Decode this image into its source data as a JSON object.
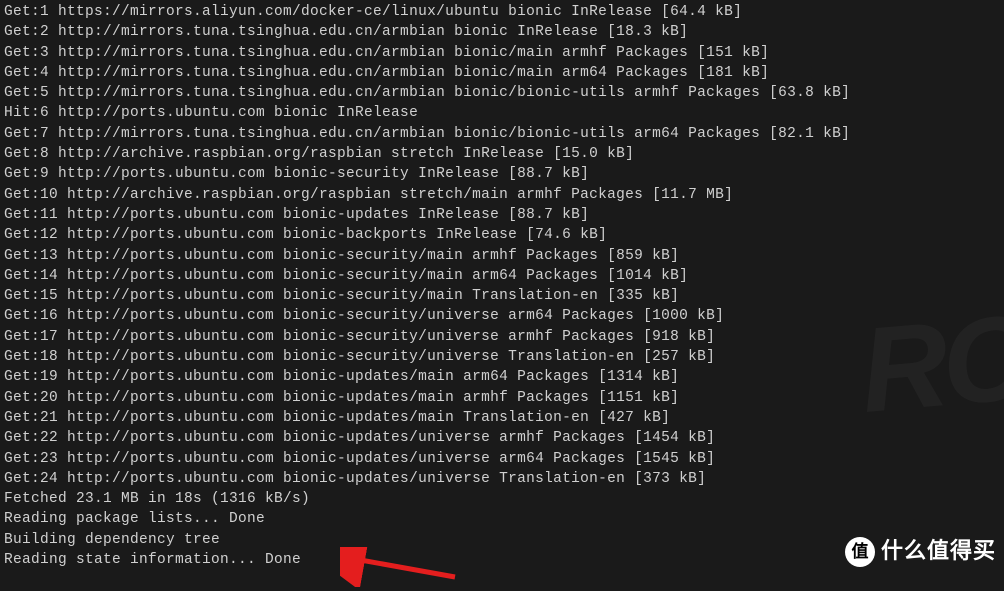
{
  "terminal": {
    "lines": [
      "Get:1 https://mirrors.aliyun.com/docker-ce/linux/ubuntu bionic InRelease [64.4 kB]",
      "Get:2 http://mirrors.tuna.tsinghua.edu.cn/armbian bionic InRelease [18.3 kB]",
      "Get:3 http://mirrors.tuna.tsinghua.edu.cn/armbian bionic/main armhf Packages [151 kB]",
      "Get:4 http://mirrors.tuna.tsinghua.edu.cn/armbian bionic/main arm64 Packages [181 kB]",
      "Get:5 http://mirrors.tuna.tsinghua.edu.cn/armbian bionic/bionic-utils armhf Packages [63.8 kB]",
      "Hit:6 http://ports.ubuntu.com bionic InRelease",
      "Get:7 http://mirrors.tuna.tsinghua.edu.cn/armbian bionic/bionic-utils arm64 Packages [82.1 kB]",
      "Get:8 http://archive.raspbian.org/raspbian stretch InRelease [15.0 kB]",
      "Get:9 http://ports.ubuntu.com bionic-security InRelease [88.7 kB]",
      "Get:10 http://archive.raspbian.org/raspbian stretch/main armhf Packages [11.7 MB]",
      "Get:11 http://ports.ubuntu.com bionic-updates InRelease [88.7 kB]",
      "Get:12 http://ports.ubuntu.com bionic-backports InRelease [74.6 kB]",
      "Get:13 http://ports.ubuntu.com bionic-security/main armhf Packages [859 kB]",
      "Get:14 http://ports.ubuntu.com bionic-security/main arm64 Packages [1014 kB]",
      "Get:15 http://ports.ubuntu.com bionic-security/main Translation-en [335 kB]",
      "Get:16 http://ports.ubuntu.com bionic-security/universe arm64 Packages [1000 kB]",
      "Get:17 http://ports.ubuntu.com bionic-security/universe armhf Packages [918 kB]",
      "Get:18 http://ports.ubuntu.com bionic-security/universe Translation-en [257 kB]",
      "Get:19 http://ports.ubuntu.com bionic-updates/main arm64 Packages [1314 kB]",
      "Get:20 http://ports.ubuntu.com bionic-updates/main armhf Packages [1151 kB]",
      "Get:21 http://ports.ubuntu.com bionic-updates/main Translation-en [427 kB]",
      "Get:22 http://ports.ubuntu.com bionic-updates/universe armhf Packages [1454 kB]",
      "Get:23 http://ports.ubuntu.com bionic-updates/universe arm64 Packages [1545 kB]",
      "Get:24 http://ports.ubuntu.com bionic-updates/universe Translation-en [373 kB]",
      "Fetched 23.1 MB in 18s (1316 kB/s)",
      "Reading package lists... Done",
      "Building dependency tree",
      "Reading state information... Done"
    ]
  },
  "brand": {
    "badge": "值",
    "text": "什么值得买"
  },
  "watermark": "RC"
}
